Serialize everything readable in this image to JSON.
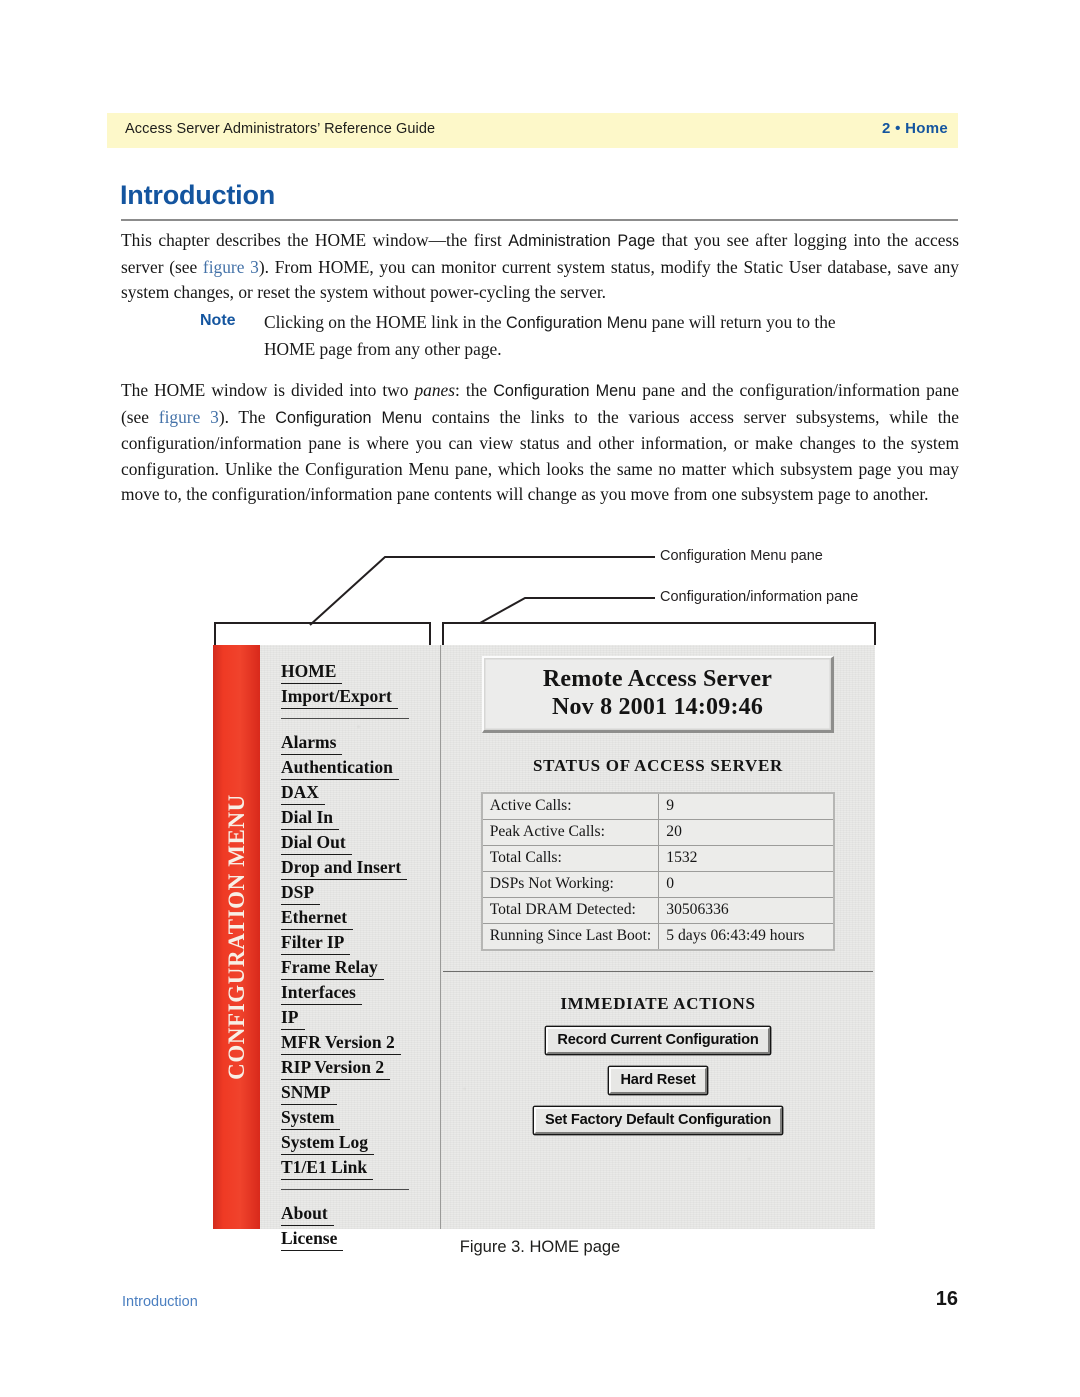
{
  "header": {
    "left_text": "Access Server Administrators’ Reference Guide",
    "right_text": "2 • Home",
    "band_color": "#fdf8c9",
    "accent_color": "#14559f"
  },
  "heading": {
    "title": "Introduction"
  },
  "paragraphs": {
    "p1_a": "This chapter describes the HOME window—the first ",
    "p1_sans1": "Administration Page",
    "p1_b": " that you see after logging into the access server (see ",
    "p1_xref": "figure 3",
    "p1_c": "). From HOME, you can monitor current system status, modify the Static User database, save any system changes, or reset the system without power-cycling the server.",
    "p2_a": "The HOME window is divided into two ",
    "p2_ital": "panes",
    "p2_b": ": the ",
    "p2_sans1": "Configuration Menu",
    "p2_c": " pane and the configuration/information pane (see ",
    "p2_xref": "figure 3",
    "p2_d": "). The ",
    "p2_sans2": "Configuration Menu",
    "p2_e": " contains the links to the various access server subsystems, while the configuration/information pane is where you can view status and other information, or make changes to the system configuration. Unlike the Configuration Menu pane, which looks the same no matter which subsystem page you may move to, the configuration/information pane contents will change as you move from one subsystem page to another."
  },
  "note": {
    "label": "Note",
    "text_a": "Clicking on the HOME link in the ",
    "text_sans": "Configuration Menu",
    "text_b": " pane will return you to the HOME page from any other page."
  },
  "callouts": {
    "menu_pane": "Configuration Menu pane",
    "info_pane": "Configuration/information pane"
  },
  "screenshot": {
    "menu_bar_label": "CONFIGURATION MENU",
    "menu_bar_color": "#ef3a24",
    "nav_group_1": [
      {
        "label": "HOME"
      },
      {
        "label": "Import/Export"
      }
    ],
    "nav_group_2": [
      {
        "label": "Alarms"
      },
      {
        "label": "Authentication"
      },
      {
        "label": "DAX"
      },
      {
        "label": "Dial In"
      },
      {
        "label": "Dial Out"
      },
      {
        "label": "Drop and Insert"
      },
      {
        "label": "DSP"
      },
      {
        "label": "Ethernet"
      },
      {
        "label": "Filter IP"
      },
      {
        "label": "Frame Relay"
      },
      {
        "label": "Interfaces"
      },
      {
        "label": "IP"
      },
      {
        "label": "MFR Version 2"
      },
      {
        "label": "RIP Version 2"
      },
      {
        "label": "SNMP"
      },
      {
        "label": "System"
      },
      {
        "label": "System Log"
      },
      {
        "label": "T1/E1 Link"
      }
    ],
    "nav_group_3": [
      {
        "label": "About"
      },
      {
        "label": "License"
      }
    ],
    "banner": {
      "line1": "Remote Access Server",
      "line2": "Nov 8 2001 14:09:46"
    },
    "status_title": "STATUS OF ACCESS SERVER",
    "status_rows": [
      {
        "key": "Active Calls:",
        "value": "9"
      },
      {
        "key": "Peak Active Calls:",
        "value": "20"
      },
      {
        "key": "Total Calls:",
        "value": "1532"
      },
      {
        "key": "DSPs Not Working:",
        "value": "0"
      },
      {
        "key": "Total DRAM Detected:",
        "value": "30506336"
      },
      {
        "key": "Running Since Last Boot:",
        "value": "5 days 06:43:49 hours"
      }
    ],
    "actions_title": "IMMEDIATE ACTIONS",
    "buttons": [
      {
        "label": "Record Current Configuration"
      },
      {
        "label": "Hard Reset"
      },
      {
        "label": "Set Factory Default Configuration"
      }
    ]
  },
  "figure_caption": "Figure 3. HOME page",
  "footer": {
    "left": "Introduction",
    "page_number": "16"
  }
}
